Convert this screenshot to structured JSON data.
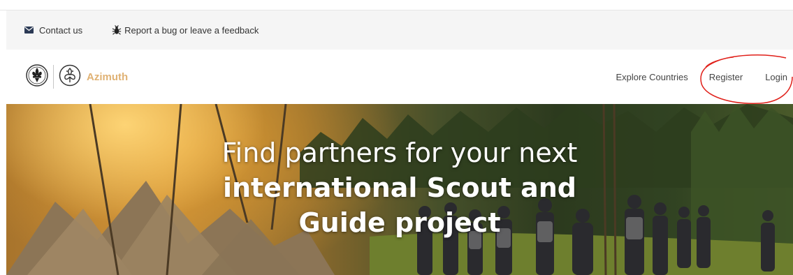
{
  "topbar": {
    "contact_label": "Contact us",
    "feedback_label": "Report a bug or leave a feedback"
  },
  "brand": {
    "name": "Azimuth",
    "color": "#e0b274"
  },
  "nav": {
    "explore": "Explore Countries",
    "register": "Register",
    "login": "Login",
    "annotation_color": "#e0201a"
  },
  "hero": {
    "line1": "Find partners for your next",
    "line2": "international Scout and",
    "line3": "Guide project"
  },
  "icons": [
    "envelope-icon",
    "bug-icon",
    "scout-emblem-icon",
    "guide-emblem-icon"
  ]
}
